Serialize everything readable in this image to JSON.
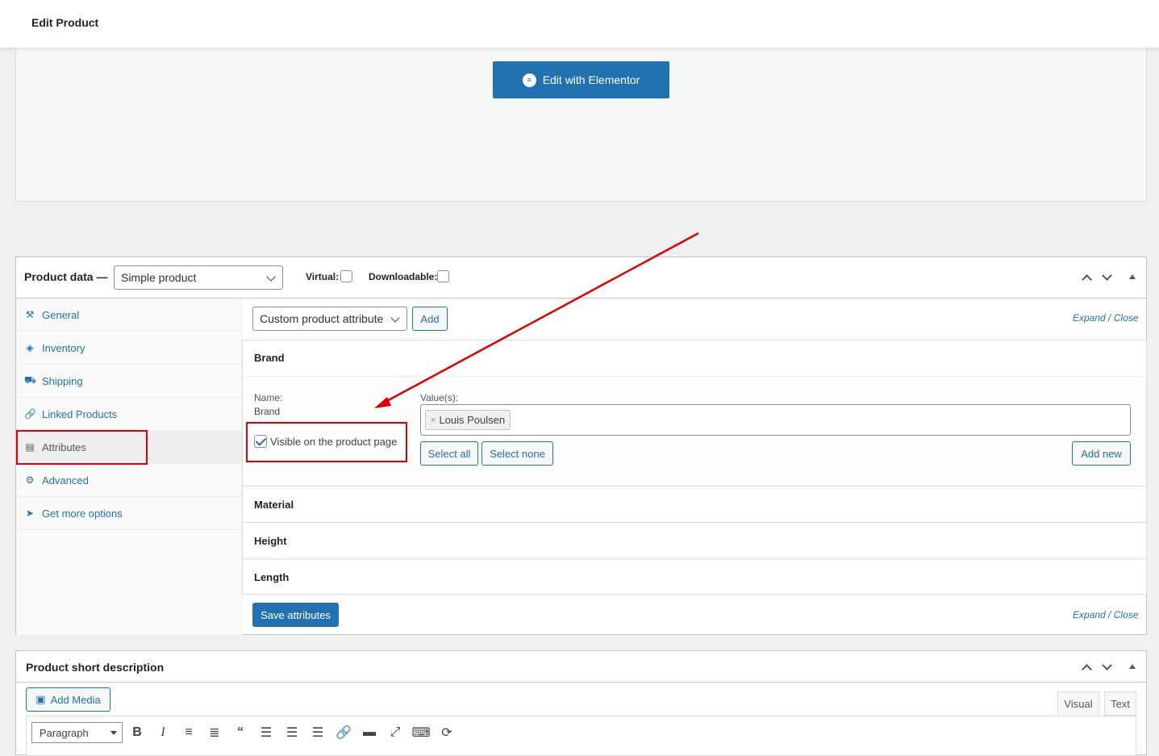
{
  "header": {
    "title": "Edit Product"
  },
  "elementor": {
    "button_label": "Edit with Elementor"
  },
  "product_data": {
    "label": "Product data —",
    "type_value": "Simple product",
    "virtual_label": "Virtual:",
    "downloadable_label": "Downloadable:",
    "tabs": [
      {
        "label": "General",
        "icon": "wrench-icon"
      },
      {
        "label": "Inventory",
        "icon": "tag-icon"
      },
      {
        "label": "Shipping",
        "icon": "truck-icon"
      },
      {
        "label": "Linked Products",
        "icon": "link-icon"
      },
      {
        "label": "Attributes",
        "icon": "list-icon"
      },
      {
        "label": "Advanced",
        "icon": "gear-icon"
      },
      {
        "label": "Get more options",
        "icon": "plugin-icon"
      }
    ],
    "attribute_select": "Custom product attribute",
    "add_label": "Add",
    "expand": "Expand",
    "separator": "/",
    "close": "Close",
    "attributes": [
      {
        "name": "Brand"
      },
      {
        "name": "Material"
      },
      {
        "name": "Height"
      },
      {
        "name": "Length"
      }
    ],
    "brand_detail": {
      "name_label": "Name:",
      "name_value": "Brand",
      "values_label": "Value(s):",
      "token": "Louis Poulsen",
      "visible_label": "Visible on the product page",
      "select_all": "Select all",
      "select_none": "Select none",
      "add_new": "Add new"
    },
    "save_label": "Save attributes"
  },
  "short_description": {
    "title": "Product short description",
    "add_media": "Add Media",
    "visual_tab": "Visual",
    "text_tab": "Text",
    "format_value": "Paragraph"
  },
  "colors": {
    "accent": "#2271b1",
    "annotation": "#e00000"
  }
}
